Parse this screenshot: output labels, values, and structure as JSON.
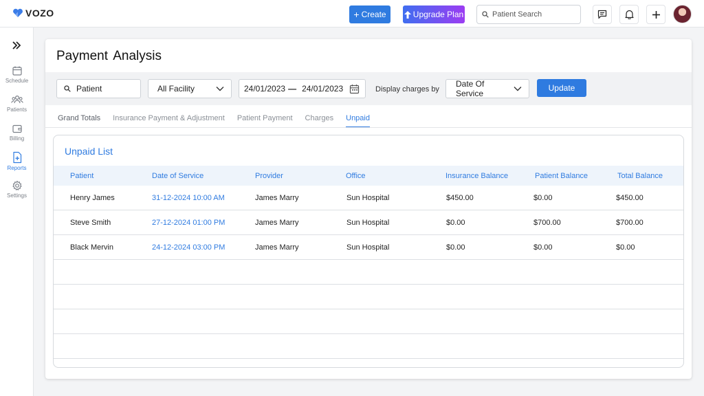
{
  "header": {
    "logo_text": "VOZO",
    "create_label": "Create",
    "upgrade_label": "Upgrade Plan",
    "search_placeholder": "Patient Search"
  },
  "sidebar": {
    "items": [
      {
        "label": "Schedule",
        "icon": "calendar-icon"
      },
      {
        "label": "Patients",
        "icon": "users-icon"
      },
      {
        "label": "Billing",
        "icon": "wallet-icon"
      },
      {
        "label": "Reports",
        "icon": "report-icon"
      },
      {
        "label": "Settings",
        "icon": "gear-icon"
      }
    ],
    "active": "Reports"
  },
  "page": {
    "title": "Payment  Analysis"
  },
  "filters": {
    "patient_value": "Patient",
    "facility_value": "All Facility",
    "date_from": "24/01/2023",
    "date_to": "24/01/2023",
    "date_separator": "—",
    "display_label": "Display charges by",
    "display_value": "Date Of Service",
    "update_label": "Update"
  },
  "tabs": [
    {
      "label": "Grand Totals"
    },
    {
      "label": "Insurance Payment & Adjustment"
    },
    {
      "label": "Patient Payment"
    },
    {
      "label": "Charges"
    },
    {
      "label": "Unpaid"
    }
  ],
  "unpaid": {
    "title": "Unpaid List",
    "columns": [
      "Patient",
      "Date of Service",
      "Provider",
      "Office",
      "Insurance Balance",
      "Patient Balance",
      "Total Balance"
    ],
    "rows": [
      [
        "Henry James",
        "31-12-2024 10:00 AM",
        "James Marry",
        "Sun Hospital",
        "$450.00",
        "$0.00",
        "$450.00"
      ],
      [
        "Steve Smith",
        "27-12-2024 01:00 PM",
        "James Marry",
        "Sun Hospital",
        "$0.00",
        "$700.00",
        "$700.00"
      ],
      [
        "Black Mervin",
        "24-12-2024 03:00 PM",
        "James Marry",
        "Sun Hospital",
        "$0.00",
        "$0.00",
        "$0.00"
      ]
    ]
  },
  "colors": {
    "accent": "#2f7be0",
    "upgrade_gradient_start": "#3f6ef0",
    "upgrade_gradient_end": "#9c3df2"
  }
}
